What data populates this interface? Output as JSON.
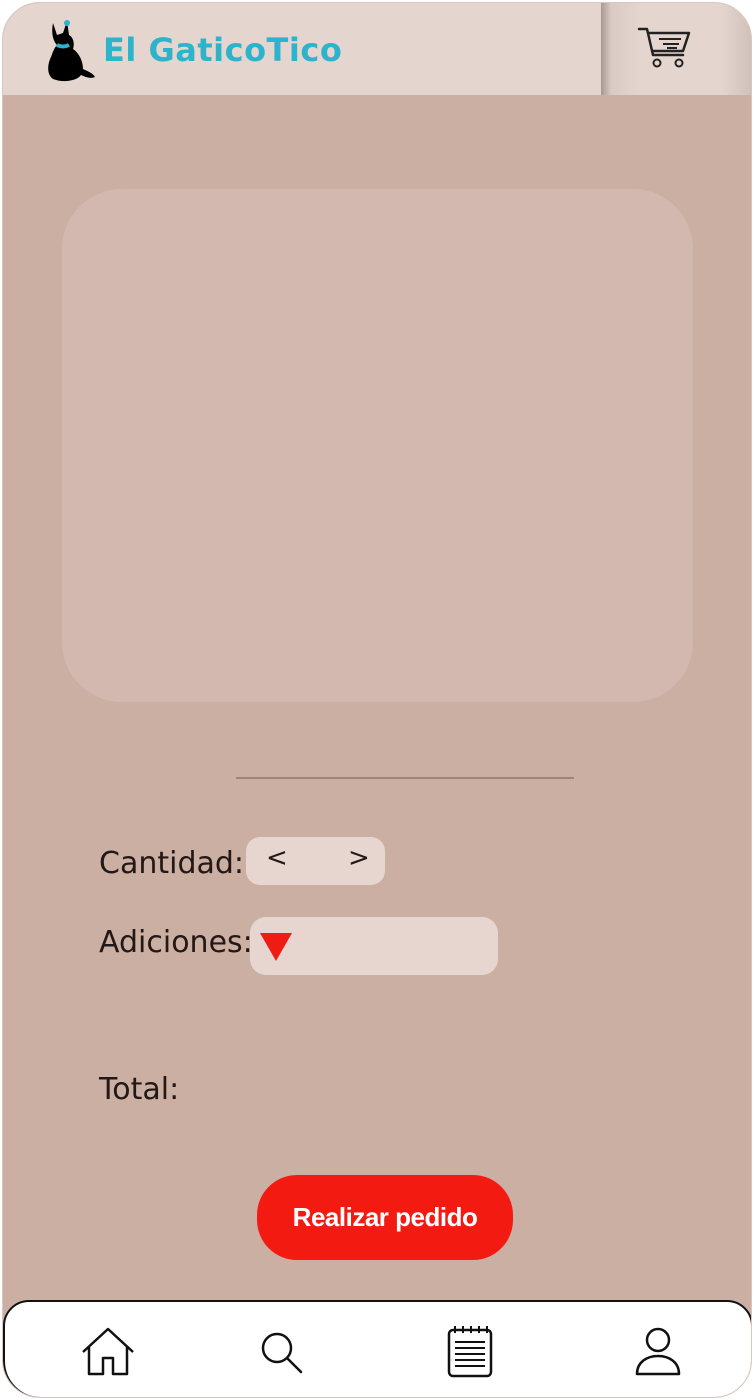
{
  "header": {
    "brand_name": "El GaticoTico",
    "logo_icon": "cat-icon",
    "cart_icon": "cart-icon"
  },
  "product": {
    "image_placeholder": ""
  },
  "form": {
    "quantity_label": "Cantidad:",
    "quantity_decrement": "<",
    "quantity_increment": ">",
    "additions_label": "Adiciones:",
    "additions_dropdown_icon": "dropdown-triangle-icon",
    "total_label": "Total:"
  },
  "actions": {
    "order_button_label": "Realizar pedido"
  },
  "bottom_nav": {
    "items": [
      {
        "icon": "home-icon"
      },
      {
        "icon": "search-icon"
      },
      {
        "icon": "notepad-icon"
      },
      {
        "icon": "user-icon"
      }
    ]
  },
  "colors": {
    "background": "#cbafa2",
    "header": "#e4d6cf",
    "brand": "#2db3cc",
    "card": "#d2b8ae",
    "control": "#e6d6cf",
    "accent": "#f31a12"
  }
}
